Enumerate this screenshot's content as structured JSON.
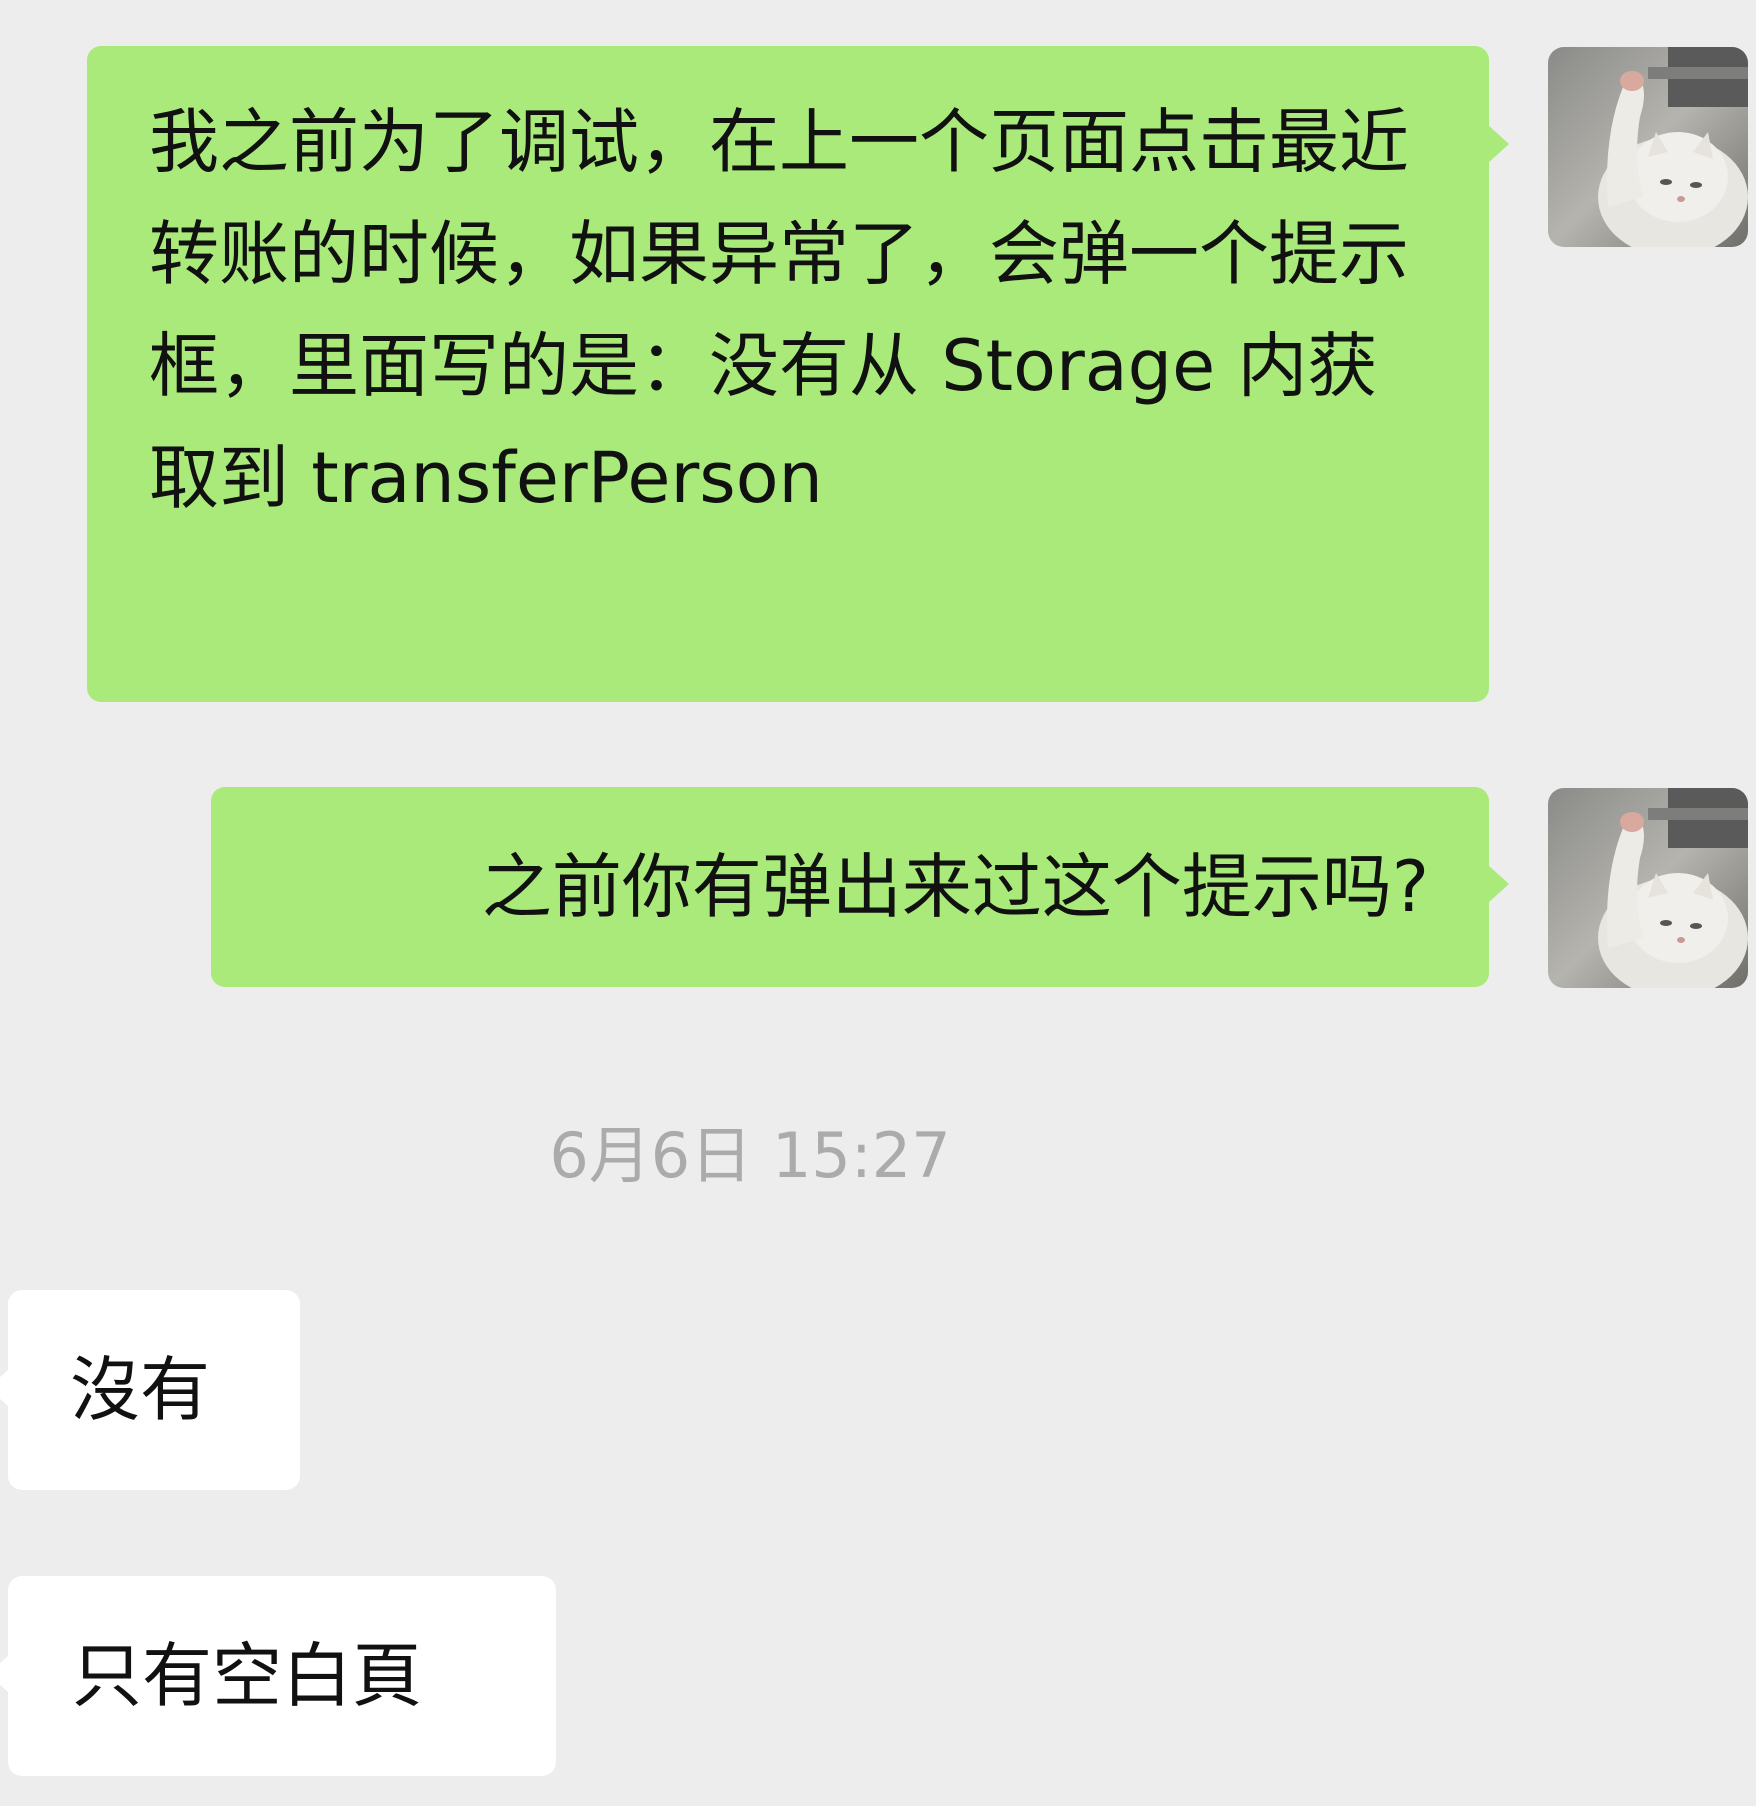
{
  "chat": {
    "messages": [
      {
        "direction": "sent",
        "text": "我之前为了调试，在上一个页面点击最近转账的时候，如果异常了，会弹一个提示框，里面写的是：没有从 Storage 内获取到 transferPerson"
      },
      {
        "direction": "sent",
        "text": "之前你有弹出来过这个提示吗?"
      },
      {
        "direction": "received",
        "text": "沒有"
      },
      {
        "direction": "received",
        "text": "只有空白頁"
      }
    ],
    "timestamp": "6月6日 15:27",
    "avatar_icon": "cat-photo-icon"
  },
  "colors": {
    "background": "#ededed",
    "sent_bubble": "#a9ea7a",
    "received_bubble": "#ffffff",
    "timestamp_text": "#ababab",
    "message_text": "#111111"
  }
}
